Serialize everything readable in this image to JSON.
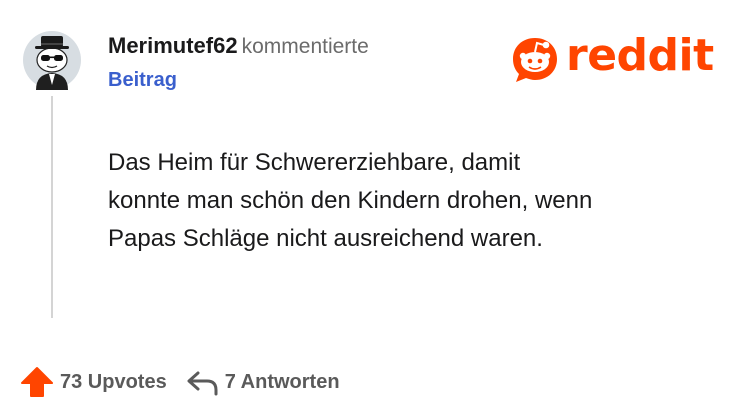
{
  "comment": {
    "username": "Merimutef62",
    "action": "kommentierte",
    "post_link": "Beitrag",
    "body_lines": [
      "Das Heim für Schwererziehbare, damit",
      "konnte man schön den Kindern drohen, wenn",
      "Papas Schläge nicht ausreichend waren."
    ]
  },
  "logo": {
    "text": "reddit"
  },
  "footer": {
    "upvotes_label": "73 Upvotes",
    "replies_label": "7 Antworten"
  },
  "colors": {
    "brand": "#ff4500",
    "link": "#3a5fcd",
    "muted": "#6b6b6b"
  }
}
